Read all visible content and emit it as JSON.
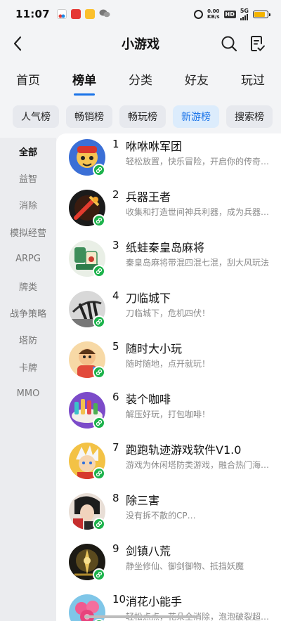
{
  "status_bar": {
    "time": "11:07",
    "net_speed_value": "0.00",
    "net_speed_unit": "KB/s",
    "hd": "HD",
    "network": "5G",
    "battery_level": 0.85
  },
  "header": {
    "title": "小游戏"
  },
  "tabs": [
    {
      "label": "首页"
    },
    {
      "label": "榜单",
      "active": true
    },
    {
      "label": "分类"
    },
    {
      "label": "好友"
    },
    {
      "label": "玩过"
    }
  ],
  "chips": [
    {
      "label": "人气榜"
    },
    {
      "label": "畅销榜"
    },
    {
      "label": "畅玩榜"
    },
    {
      "label": "新游榜",
      "active": true
    },
    {
      "label": "搜索榜"
    }
  ],
  "categories": [
    {
      "label": "全部",
      "active": true
    },
    {
      "label": "益智"
    },
    {
      "label": "消除"
    },
    {
      "label": "模拟经营"
    },
    {
      "label": "ARPG"
    },
    {
      "label": "牌类"
    },
    {
      "label": "战争策略"
    },
    {
      "label": "塔防"
    },
    {
      "label": "卡牌"
    },
    {
      "label": "MMO"
    }
  ],
  "games": [
    {
      "rank": "1",
      "name": "咻咻咻军团",
      "desc": "轻松放置，快乐冒险，开启你的传奇之旅",
      "icon": "cartoon-hero-icon"
    },
    {
      "rank": "2",
      "name": "兵器王者",
      "desc": "收集和打造世间神兵利器，成为兵器王者",
      "icon": "sword-icon"
    },
    {
      "rank": "3",
      "name": "纸蛙秦皇岛麻将",
      "desc": "秦皇岛麻将带混四混七混，刮大风玩法",
      "icon": "mahjong-icon"
    },
    {
      "rank": "4",
      "name": "刀临城下",
      "desc": "刀临城下，危机四伏！",
      "icon": "blade-icon"
    },
    {
      "rank": "5",
      "name": "随时大小玩",
      "desc": "随时随地，点开就玩！",
      "icon": "kid-cartoon-icon"
    },
    {
      "rank": "6",
      "name": "装个咖啡",
      "desc": "解压好玩，打包咖啡！",
      "icon": "coffee-cups-icon"
    },
    {
      "rank": "7",
      "name": "跑跑轨迹游戏软件V1.0",
      "desc": "游戏为休闲塔防类游戏，融合热门海岛元素",
      "icon": "anime-character-icon"
    },
    {
      "rank": "8",
      "name": "除三害",
      "desc": "没有拆不散的CP…",
      "icon": "couple-portrait-icon"
    },
    {
      "rank": "9",
      "name": "剑镇八荒",
      "desc": "静坐修仙、御剑御物、抵挡妖魔",
      "icon": "immortal-warrior-icon"
    },
    {
      "rank": "10",
      "name": "消花小能手",
      "desc": "轻松点点，花朵全消除，泡泡破裂超解压",
      "icon": "rose-flower-icon"
    }
  ],
  "colors": {
    "accent": "#1a73e8",
    "mini_program_badge": "#1db34c",
    "muted_text": "#8a8a8a"
  }
}
